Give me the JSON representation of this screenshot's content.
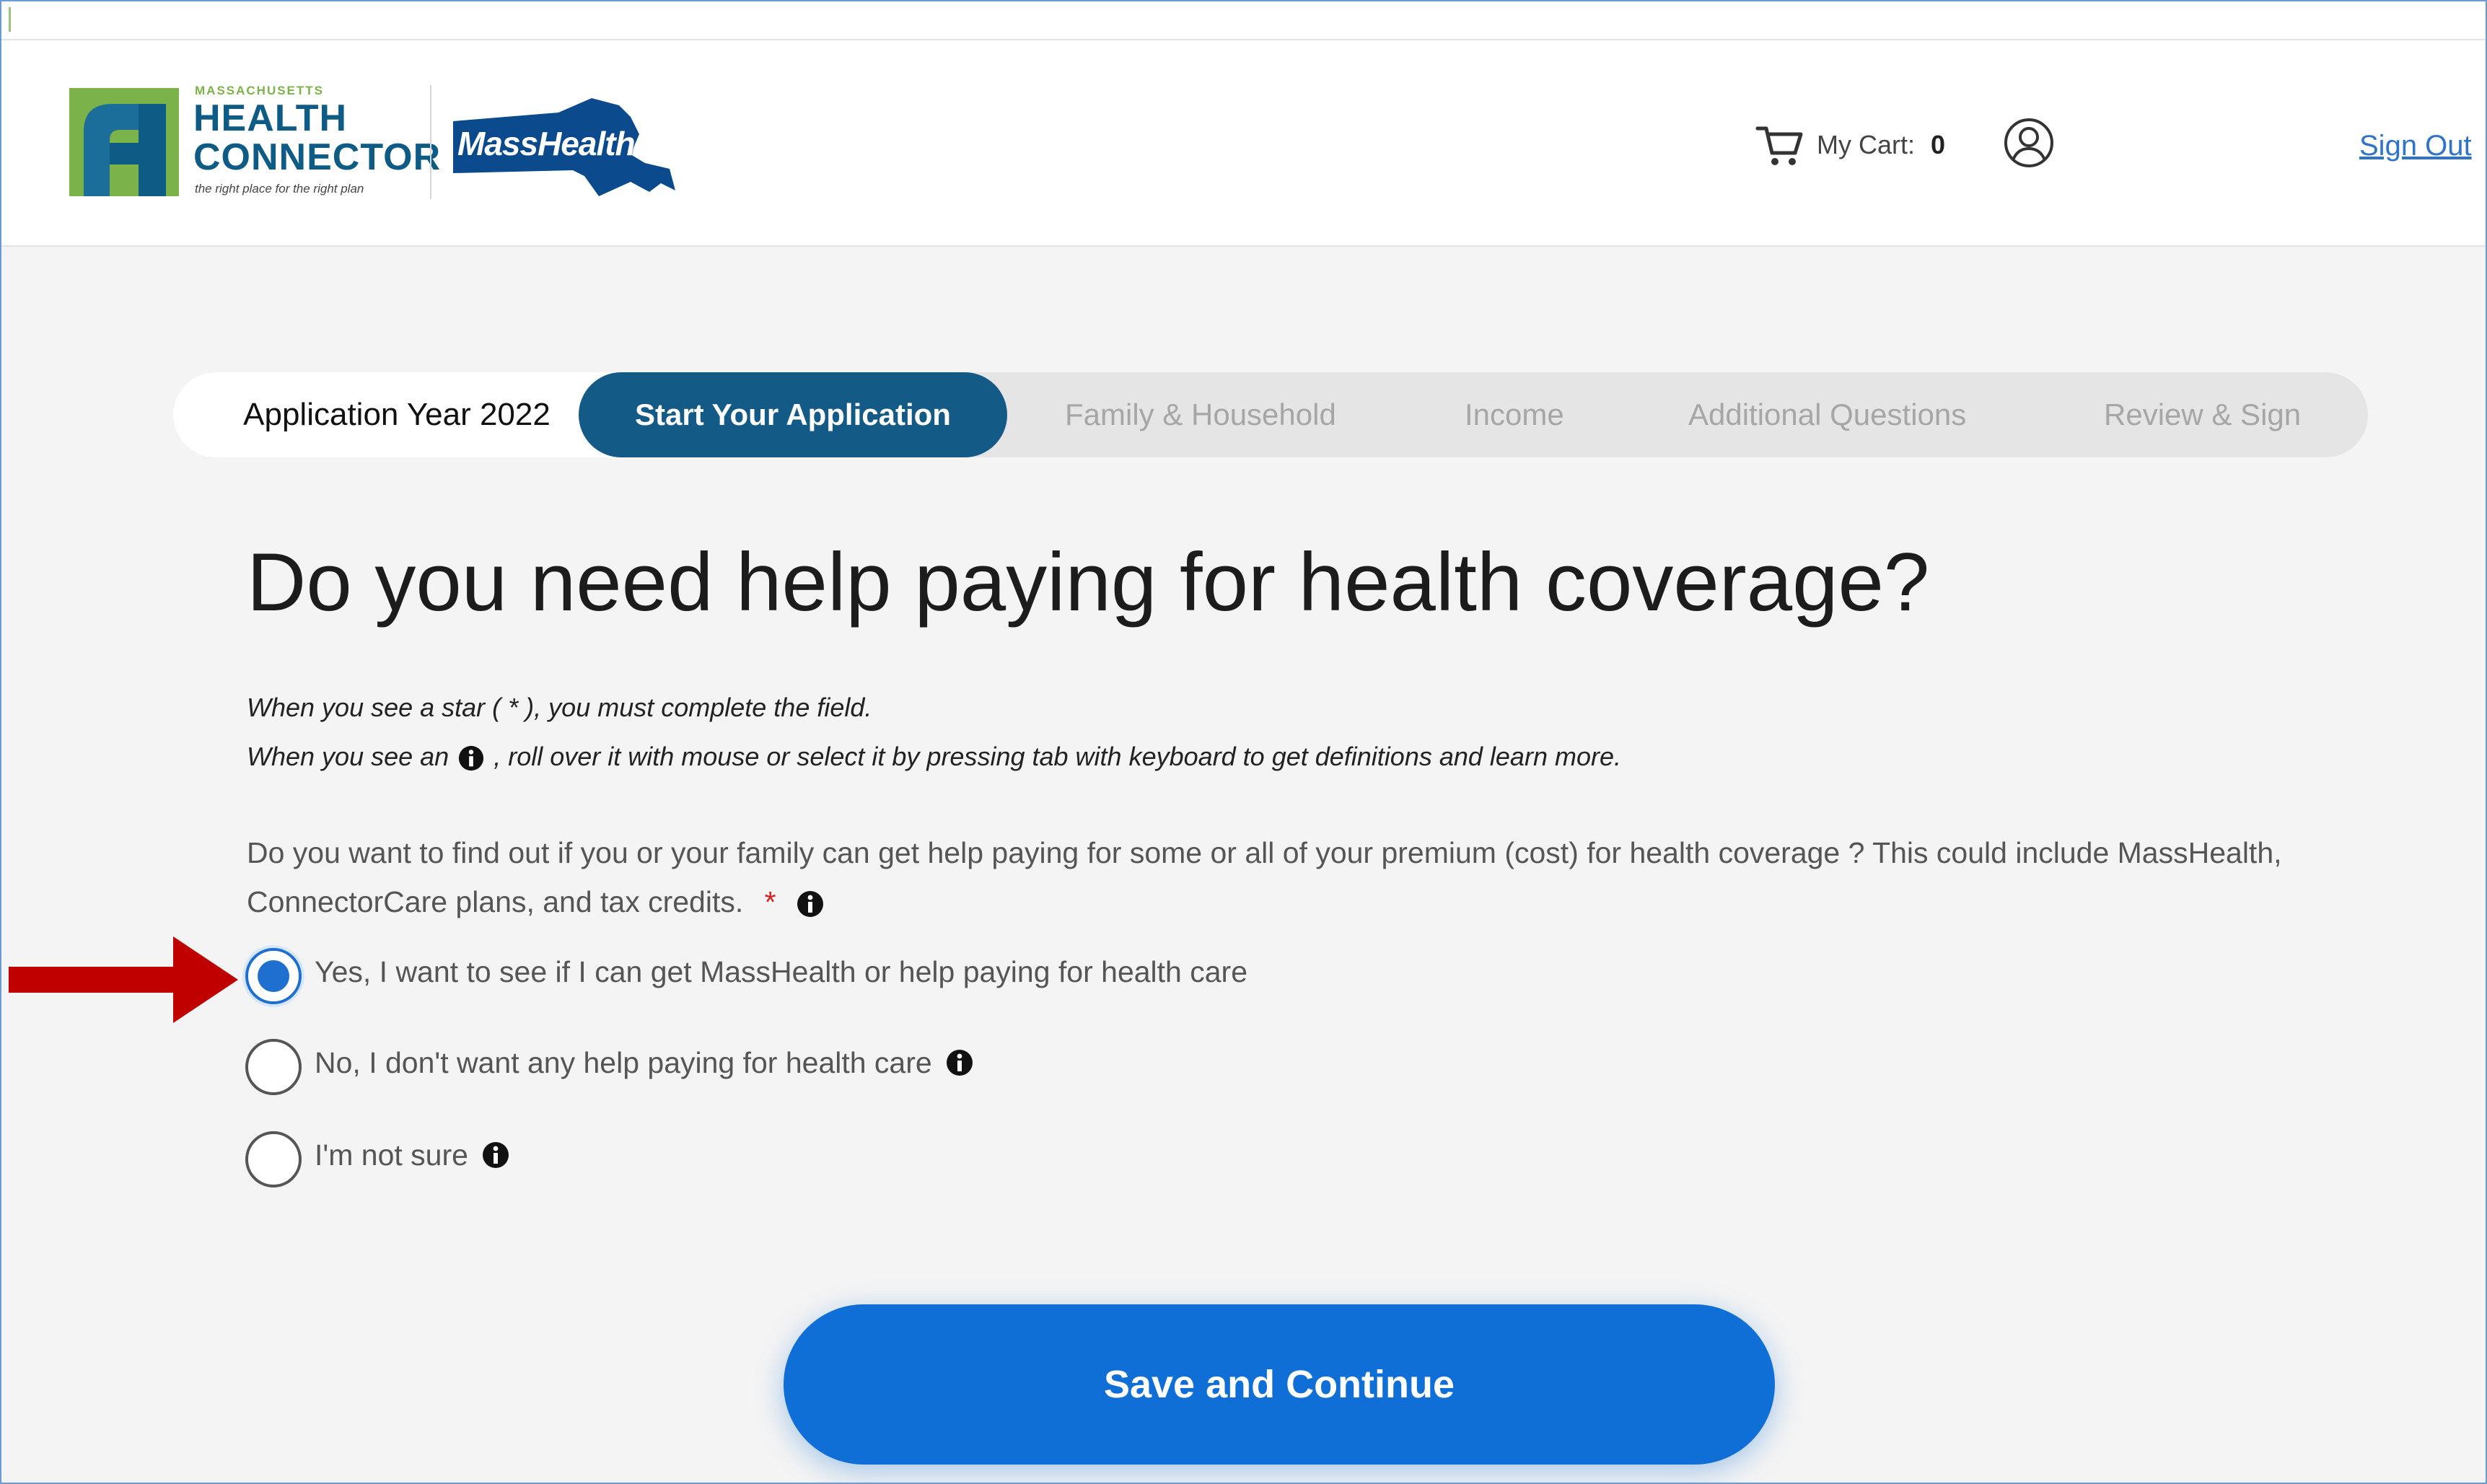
{
  "header": {
    "health_connector_logo": {
      "small_text": "MASSACHUSETTS",
      "line1": "HEALTH",
      "line2": "CONNECTOR",
      "tagline": "the right place for the right plan"
    },
    "masshealth_logo": {
      "text": "MassHealth"
    },
    "cart": {
      "label": "My Cart:",
      "count": "0",
      "icon": "cart-icon"
    },
    "user_icon": "user-icon",
    "sign_out": "Sign Out"
  },
  "progress": {
    "year": "Application Year 2022",
    "steps": [
      {
        "label": "Start Your Application",
        "active": true
      },
      {
        "label": "Family & Household",
        "active": false
      },
      {
        "label": "Income",
        "active": false
      },
      {
        "label": "Additional Questions",
        "active": false
      },
      {
        "label": "Review & Sign",
        "active": false
      }
    ]
  },
  "page": {
    "title": "Do you need help paying for health coverage?",
    "note1": "When you see a star ( * ), you must complete the field.",
    "note2_before": "When you see an",
    "note2_after": ", roll over it with mouse or select it by pressing tab with keyboard to get definitions and learn more.",
    "question": "Do you want to find out if you or your family can get help paying for some or all of your premium (cost) for health coverage ? This could include MassHealth, ConnectorCare plans, and tax credits.",
    "required_mark": "*",
    "options": [
      {
        "label": "Yes, I want to see if I can get MassHealth or help paying for health care",
        "selected": true
      },
      {
        "label": "No, I don't want any help paying for health care",
        "selected": false
      },
      {
        "label": "I'm not sure",
        "selected": false
      }
    ],
    "save_button": "Save and Continue"
  },
  "colors": {
    "brand_dark_blue": "#145a86",
    "button_blue": "#0f6fd6",
    "link_blue": "#2f74c9",
    "required_red": "#d62020",
    "annotation_arrow": "#c00000"
  }
}
